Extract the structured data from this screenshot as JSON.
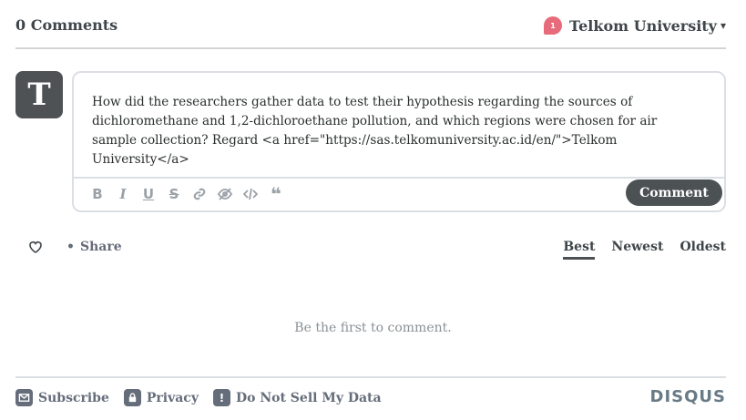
{
  "header": {
    "comment_count": "0 Comments",
    "community_name": "Telkom University",
    "notification_count": "1",
    "caret": "▾"
  },
  "avatar": {
    "initial": "T"
  },
  "editor": {
    "text": "How did the researchers gather data to test their hypothesis regarding the sources of dichloromethane and 1,2-dichloroethane pollution, and which regions were chosen for air sample collection? Regard <a href=\"https://sas.telkomuniversity.ac.id/en/\">Telkom University</a>",
    "toolbar_icons": [
      "bold-icon",
      "italic-icon",
      "underline-icon",
      "strikethrough-icon",
      "link-icon",
      "spoiler-icon",
      "code-icon",
      "quote-icon"
    ],
    "submit_label": "Comment"
  },
  "actions": {
    "share_label": "Share",
    "sort_options": [
      "Best",
      "Newest",
      "Oldest"
    ],
    "active_sort": "Best"
  },
  "empty_message": "Be the first to comment.",
  "footer": {
    "subscribe_label": "Subscribe",
    "privacy_label": "Privacy",
    "do_not_sell_label": "Do Not Sell My Data",
    "brand": "DISQUS"
  },
  "colors": {
    "badge": "#e76c7b",
    "button": "#4c5154",
    "muted": "#656c7a"
  }
}
